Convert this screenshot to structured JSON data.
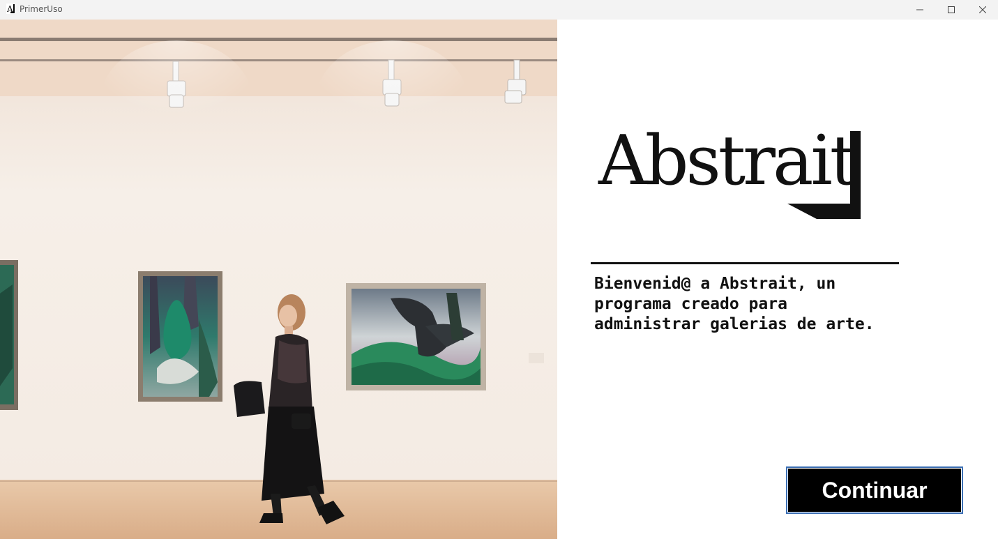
{
  "window": {
    "title": "PrimerUso",
    "icon": "app-logo-icon",
    "controls": [
      "minimize-icon",
      "maximize-icon",
      "close-icon"
    ]
  },
  "hero_image": {
    "description_icon": "art-gallery-photo"
  },
  "brand": {
    "logo_text": "Abstrait"
  },
  "welcome": {
    "message": "Bienvenid@ a Abstrait, un programa creado para administrar galerias de arte."
  },
  "actions": {
    "continue_label": "Continuar"
  },
  "colors": {
    "background": "#ffffff",
    "text": "#111111",
    "button_bg": "#000000",
    "button_text": "#ffffff",
    "button_focus_border": "#3c6fb4"
  }
}
